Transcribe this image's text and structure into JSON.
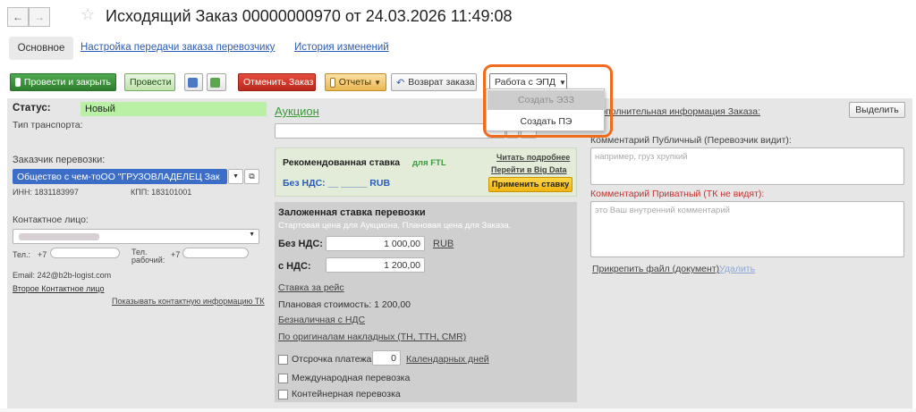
{
  "window": {
    "title": "Исходящий Заказ 00000000970 от 24.03.2026 11:49:08"
  },
  "tabs": [
    {
      "label": "Основное"
    },
    {
      "label": "Настройка передачи заказа перевозчику"
    },
    {
      "label": "История изменений"
    }
  ],
  "toolbar": {
    "post_close": "Провести и закрыть",
    "post": "Провести",
    "cancel_order": "Отменить Заказ",
    "reports": "Отчеты",
    "return_order": "Возврат заказа",
    "epd": "Работа с ЭПД"
  },
  "epd_menu": {
    "items": [
      {
        "label": "Создать ЭЗЗ",
        "disabled": true
      },
      {
        "label": "Создать ПЭ",
        "disabled": false
      }
    ]
  },
  "left": {
    "status_label": "Статус:",
    "status_value": "Новый",
    "transport_type_label": "Тип транспорта:",
    "customer_label": "Заказчик перевозки:",
    "customer_value": "Общество с чем-тоОО \"ГРУЗОВЛАДЕЛЕЦ Зак",
    "inn": "ИНН: 1831183997",
    "kpp": "КПП: 183101001",
    "contact_label": "Контактное лицо:",
    "tel_label": "Тел.:",
    "tel_prefix": "+7",
    "tel_work_label": "Тел. рабочий:",
    "tel_work_prefix": "+7",
    "email": "Email: 242@b2b-logist.com",
    "second_contact": "Второе Контактное лицо",
    "show_tk_contact": "Показывать контактную информацию ТК"
  },
  "middle": {
    "auction": "Аукцион",
    "rec_title": "Рекомендованная ставка",
    "rec_ftl": "для FTL",
    "read_more": "Читать подробнее",
    "go_big_data": "Перейти в Big Data",
    "no_vat_line": "Без НДС: __ _____ RUB",
    "apply_rate": "Применить ставку",
    "zal_title": "Заложенная ставка перевозки",
    "zal_sub": "Стартовая цена для Аукциона, Плановая цена для Заказа.",
    "no_vat_label": "Без НДС:",
    "no_vat_value": "1 000,00",
    "currency": "RUB",
    "with_vat_label": "с НДС:",
    "with_vat_value": "1 200,00",
    "rate_per_trip": "Ставка за рейс",
    "plan_cost": "Плановая стоимость: 1 200,00",
    "cashless": "Безналичная с НДС",
    "by_originals": "По оригиналам накладных (ТН, ТТН, CMR)",
    "deferral_label": "Отсрочка платежа:",
    "deferral_value": "0",
    "calendar_days": "Календарных дней",
    "international": "Международная перевозка",
    "container": "Контейнерная перевозка"
  },
  "right": {
    "additional_info": "Дополнительная информация Заказа:",
    "select_button": "Выделить",
    "public_comment_label": "Комментарий Публичный (Перевозчик видит):",
    "public_placeholder": "например, груз хрупкий",
    "private_comment_label": "Комментарий Приватный (ТК не видят):",
    "private_placeholder": "это Ваш внутренний комментарий",
    "attach_file": "Прикрепить файл (документ)",
    "delete": "Удалить"
  },
  "colors": {
    "accent_link": "#2a5bb8",
    "status_bg": "#b9f0a6",
    "highlight": "#f26a1b",
    "private_label": "#c9302c",
    "green_text": "#3a9a3a"
  }
}
